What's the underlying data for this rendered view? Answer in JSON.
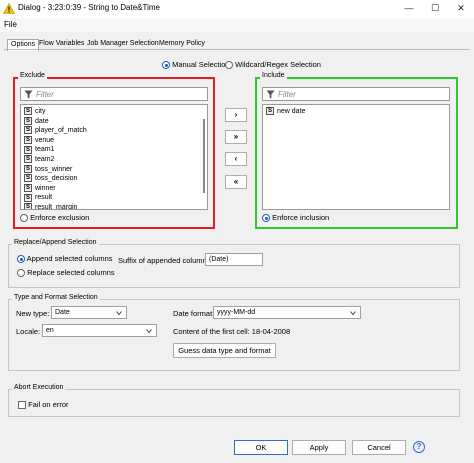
{
  "window": {
    "title": "Dialog - 3:23:0:39 - String to Date&Time",
    "minimize_glyph": "—",
    "maximize_glyph": "☐",
    "close_glyph": "✕",
    "warn_icon": "warning-triangle-icon"
  },
  "menu": {
    "file": "File"
  },
  "tabs": [
    {
      "label": "Options",
      "active": true
    },
    {
      "label": "Flow Variables",
      "active": false
    },
    {
      "label": "Job Manager Selection",
      "active": false
    },
    {
      "label": "Memory Policy",
      "active": false
    }
  ],
  "selection_mode": {
    "manual": "Manual Selection",
    "wildcard": "Wildcard/Regex Selection",
    "selected": "manual"
  },
  "exclude": {
    "title": "Exclude",
    "border_color": "#e02020",
    "filter_placeholder": "Filter",
    "items": [
      "city",
      "date",
      "player_of_match",
      "venue",
      "team1",
      "team2",
      "toss_winner",
      "toss_decision",
      "winner",
      "result",
      "result_margin"
    ],
    "enforce_label": "Enforce exclusion",
    "enforce_selected": false
  },
  "include": {
    "title": "Include",
    "border_color": "#2ec82e",
    "filter_placeholder": "Filter",
    "items": [
      "new date"
    ],
    "enforce_label": "Enforce inclusion",
    "enforce_selected": true
  },
  "move_buttons": {
    "add": "›",
    "add_all": "»",
    "remove": "‹",
    "remove_all": "«"
  },
  "type_badge": "S",
  "replace_append": {
    "title": "Replace/Append Selection",
    "append_label": "Append selected columns",
    "replace_label": "Replace selected columns",
    "selected": "append",
    "suffix_label": "Suffix of appended columns:",
    "suffix_value": "(Date)"
  },
  "type_format": {
    "title": "Type and Format Selection",
    "new_type_label": "New type:",
    "new_type_value": "Date",
    "date_format_label": "Date format:",
    "date_format_value": "yyyy-MM-dd",
    "locale_label": "Locale:",
    "locale_value": "en",
    "first_cell_text": "Content of the first cell: 18-04-2008",
    "guess_button": "Guess data type and format"
  },
  "abort": {
    "title": "Abort Execution",
    "fail_label": "Fail on error",
    "fail_checked": false
  },
  "footer": {
    "ok": "OK",
    "apply": "Apply",
    "cancel": "Cancel",
    "help": "?"
  },
  "colors": {
    "accent": "#1a5bc8",
    "ok_border": "#2b6fd6"
  }
}
